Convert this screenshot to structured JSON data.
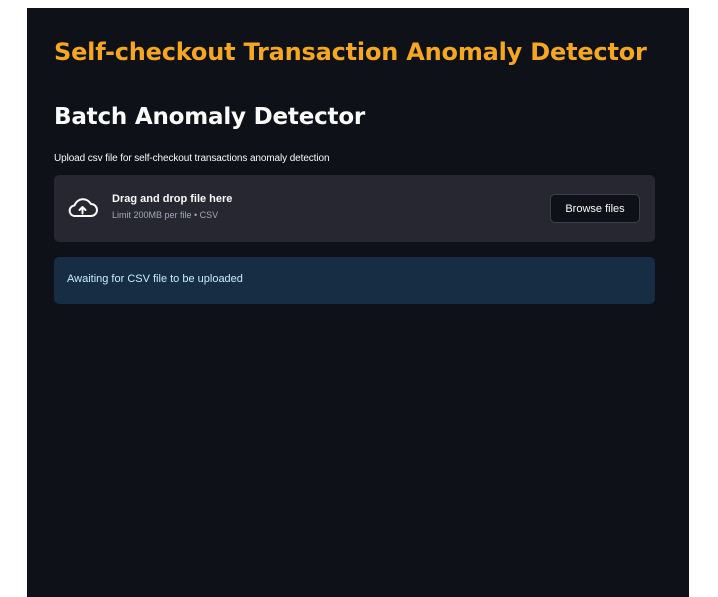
{
  "app": {
    "title": "Self-checkout Transaction Anomaly Detector"
  },
  "section": {
    "title": "Batch Anomaly Detector"
  },
  "uploader": {
    "label": "Upload csv file for self-checkout transactions anomaly detection",
    "drop_text": "Drag and drop file here",
    "limit_text": "Limit 200MB per file • CSV",
    "browse_label": "Browse files",
    "icon": "cloud-upload-icon"
  },
  "alert": {
    "message": "Awaiting for CSV file to be uploaded"
  },
  "colors": {
    "background": "#0e1117",
    "title_accent": "#f5a623",
    "dropzone": "#262730",
    "info_background": "#172d43",
    "info_text": "#c7ebff"
  }
}
